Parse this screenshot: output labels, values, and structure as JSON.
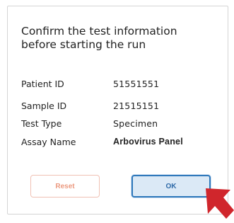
{
  "dialog": {
    "title_line1": "Confirm the test information",
    "title_line2": "before starting the run",
    "fields": [
      {
        "label": "Patient ID",
        "value": "51551551"
      },
      {
        "label": "Sample ID",
        "value": "21515151"
      },
      {
        "label": "Test Type",
        "value": "Specimen"
      },
      {
        "label": "Assay Name",
        "value": "Arbovirus Panel"
      }
    ],
    "buttons": {
      "reset_label": "Reset",
      "ok_label": "OK"
    }
  },
  "colors": {
    "reset_border": "#f0c1b4",
    "reset_text": "#ec9a80",
    "ok_background": "#dbe9f6",
    "ok_border": "#2f78bb",
    "pointer": "#d0262c"
  },
  "icons": {
    "pointer": "arrow-pointer-icon"
  }
}
